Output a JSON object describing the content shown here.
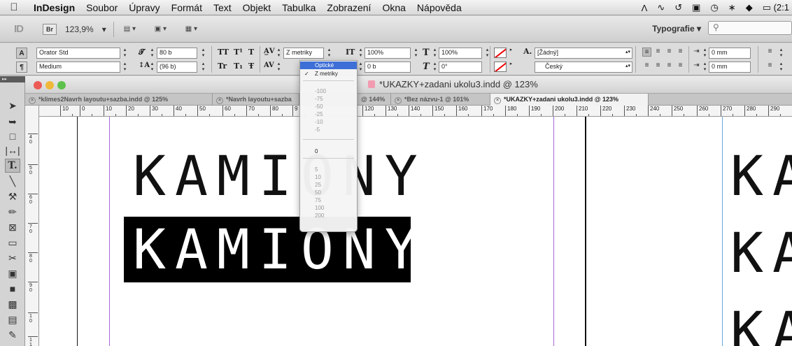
{
  "menubar": {
    "items": [
      "InDesign",
      "Soubor",
      "Úpravy",
      "Formát",
      "Text",
      "Objekt",
      "Tabulka",
      "Zobrazení",
      "Okna",
      "Nápověda"
    ],
    "status_time": "(2:1"
  },
  "appbar": {
    "logo": "ID",
    "bridge": "Br",
    "zoom": "123,9%",
    "workspace": "Typografie ▾"
  },
  "control": {
    "font_family": "Orator Std",
    "font_style": "Medium",
    "font_size": "80 b",
    "leading": "(96 b)",
    "kerning": "Z metriky",
    "vertical_scale": "100%",
    "horizontal_scale": "100%",
    "baseline_shift": "0 b",
    "skew": "0°",
    "char_style": "[Žádný]",
    "language": "Český",
    "indent_left": "0 mm",
    "indent_first": "0 mm"
  },
  "document": {
    "title": "*UKAZKY+zadani ukolu3.indd @ 123%",
    "tabs": [
      "*klimes2Navrh layoutu+sazba.indd @ 125%",
      "*Navrh layoutu+sazba",
      "@ 144%",
      "*Bez názvu-1 @ 101%",
      "*UKAZKY+zadani ukolu3.indd @ 123%"
    ],
    "hruler": [
      "10",
      "0",
      "10",
      "20",
      "30",
      "40",
      "50",
      "60",
      "70",
      "80",
      "9",
      "120",
      "130",
      "140",
      "150",
      "160",
      "170",
      "180",
      "190",
      "200",
      "210",
      "220",
      "230",
      "240",
      "250",
      "260",
      "270",
      "280",
      "290"
    ],
    "vruler": [
      "4 0",
      "5 0",
      "6 0",
      "7 0",
      "8 0",
      "9 0",
      "1 0",
      "1 1"
    ],
    "text_line1": "KAMIONY",
    "text_line2": "KAMIONY",
    "right_text": [
      "KA",
      "KA",
      "KA"
    ]
  },
  "kerning_menu": {
    "items": [
      "Optické",
      "Z metriky",
      "-100",
      "-75",
      "-50",
      "-25",
      "-10",
      "-5",
      "0",
      "5",
      "10",
      "25",
      "50",
      "75",
      "100",
      "200"
    ],
    "highlighted": "Optické",
    "checked": "Z metriky"
  },
  "colors": {
    "menu_highlight": "#3e6fd6",
    "margin_guide": "#a56ad6",
    "column_guide": "#6aa8e0",
    "black_frame": "#000000"
  }
}
